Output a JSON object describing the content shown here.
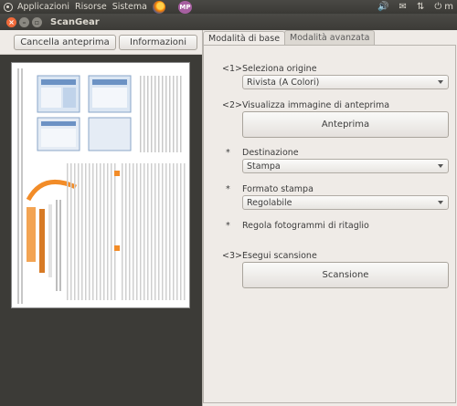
{
  "top_panel": {
    "menus": [
      "Applicazioni",
      "Risorse",
      "Sistema"
    ],
    "avatar_initials": "MP",
    "user_initial": "m"
  },
  "window": {
    "title": "ScanGear"
  },
  "left": {
    "cancel_preview_label": "Cancella anteprima",
    "info_label": "Informazioni"
  },
  "tabs": [
    {
      "label": "Modalità di base"
    },
    {
      "label": "Modalità avanzata"
    }
  ],
  "settings": {
    "step1": "<1>",
    "select_source_label": "Seleziona origine",
    "source_value": "Rivista (A Colori)",
    "step2": "<2>",
    "preview_image_label": "Visualizza immagine di anteprima",
    "preview_button_label": "Anteprima",
    "dest_marker": "*",
    "destination_label": "Destinazione",
    "destination_value": "Stampa",
    "format_marker": "*",
    "print_format_label": "Formato stampa",
    "print_format_value": "Regolabile",
    "crop_marker": "*",
    "crop_label": "Regola fotogrammi di ritaglio",
    "step3": "<3>",
    "scan_label": "Esegui scansione",
    "scan_button_label": "Scansione"
  }
}
